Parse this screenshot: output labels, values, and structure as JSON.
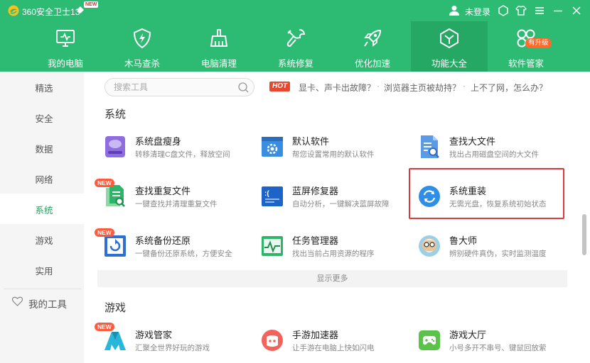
{
  "app": {
    "title": "360安全卫士13",
    "new_badge": "NEW",
    "login_text": "未登录",
    "accent": "#2dba72"
  },
  "nav": {
    "items": [
      {
        "label": "我的电脑",
        "icon": "monitor-icon"
      },
      {
        "label": "木马查杀",
        "icon": "shield-bolt-icon"
      },
      {
        "label": "电脑清理",
        "icon": "broom-icon"
      },
      {
        "label": "系统修复",
        "icon": "wrench-icon"
      },
      {
        "label": "优化加速",
        "icon": "rocket-icon"
      },
      {
        "label": "功能大全",
        "icon": "functions-icon",
        "active": true
      },
      {
        "label": "软件管家",
        "icon": "software-icon",
        "badge": "有升级"
      }
    ]
  },
  "sidebar": {
    "items": [
      {
        "label": "精选"
      },
      {
        "label": "安全"
      },
      {
        "label": "数据"
      },
      {
        "label": "网络"
      },
      {
        "label": "系统",
        "active": true
      },
      {
        "label": "游戏"
      },
      {
        "label": "实用"
      }
    ],
    "my_tools": "我的工具"
  },
  "search": {
    "placeholder": "搜索工具",
    "hot_badge": "HOT",
    "hot_links": [
      "显卡、声卡出故障？",
      "浏览器主页被劫持？",
      "上不了网，怎么办？"
    ],
    "separator": "·"
  },
  "sections": {
    "system": {
      "title": "系统",
      "tools": [
        {
          "title": "系统盘瘦身",
          "desc": "转移清理C盘文件，释放空间",
          "icon": "disk-icon"
        },
        {
          "title": "默认软件",
          "desc": "帮您设置常用的默认软件",
          "icon": "settings-window-icon"
        },
        {
          "title": "查找大文件",
          "desc": "找出占用磁盘空间的大文件",
          "icon": "file-search-icon"
        },
        {
          "title": "查找重复文件",
          "desc": "一键查找并清理重复文件",
          "icon": "duplicate-file-icon",
          "new": "NEW"
        },
        {
          "title": "蓝屏修复器",
          "desc": "自动分析，一键解决蓝屏故障",
          "icon": "bluescreen-icon"
        },
        {
          "title": "系统重装",
          "desc": "无需光盘，恢复系统初始状态",
          "icon": "reinstall-icon"
        },
        {
          "title": "系统备份还原",
          "desc": "一键备份还原系统，方便安全",
          "icon": "backup-restore-icon",
          "new": "NEW"
        },
        {
          "title": "任务管理器",
          "desc": "找出当前占用资源的程序",
          "icon": "task-manager-icon"
        },
        {
          "title": "鲁大师",
          "desc": "辨别硬件真伪，实时监测温度",
          "icon": "ludashi-icon"
        }
      ],
      "show_more": "显示更多"
    },
    "games": {
      "title": "游戏",
      "tools": [
        {
          "title": "游戏管家",
          "desc": "汇聚全世界好玩的游戏",
          "icon": "game-manager-icon",
          "new": "NEW"
        },
        {
          "title": "手游加速器",
          "desc": "让手游在电脑上快如闪电",
          "icon": "mobile-game-accelerator-icon"
        },
        {
          "title": "游戏大厅",
          "desc": "小号多开不串号、键鼠回放萦",
          "icon": "game-hall-icon"
        }
      ]
    }
  }
}
